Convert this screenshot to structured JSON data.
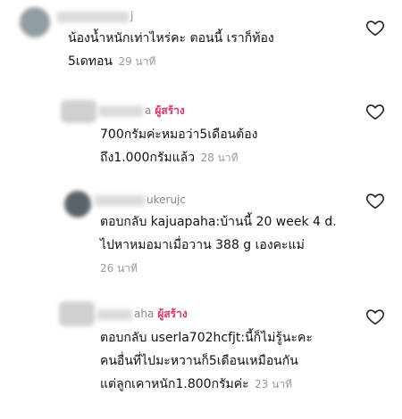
{
  "comments": [
    {
      "username_visible": "j",
      "is_creator": false,
      "lines": [
        "น้องน้ำหนักเท่าไหร่คะ ตอนนี้ เราก็ท้อง",
        "5เดทอน"
      ],
      "time": "29 นาที",
      "icon": "heart-outline-icon"
    },
    {
      "username_visible": "a",
      "is_creator": true,
      "creator_label": "ผู้สร้าง",
      "lines": [
        "700กรัมค่ะหมอว่า5เดือนต้อง",
        "ถึง1.000กรัมแล้ว"
      ],
      "time": "28 นาที",
      "icon": "heart-outline-icon"
    },
    {
      "username_visible": "ukerujc",
      "is_creator": false,
      "lines": [
        "ตอบกลับ kajuapaha:บ้านนี้ 20 week 4 d.",
        "ไปหาหมอมาเมื่อวาน 388 g เองคะแม่"
      ],
      "time": "26 นาที",
      "icon": "heart-outline-icon"
    },
    {
      "username_visible": "aha",
      "is_creator": true,
      "creator_label": "ผู้สร้าง",
      "lines": [
        "ตอบกลับ userla702hcfjt:นี้ก็ไม่รู้นะคะ",
        "คนอื่นที่ไปมะหวานก็5เดือนเหมือนกัน",
        "แต่ลูกเคาหนัก1.800กรัมค่ะ"
      ],
      "time": "23 นาที",
      "icon": "heart-outline-icon"
    }
  ],
  "colors": {
    "creator": "#e1306c",
    "timestamp": "#9a9a9a",
    "text": "#111111"
  }
}
